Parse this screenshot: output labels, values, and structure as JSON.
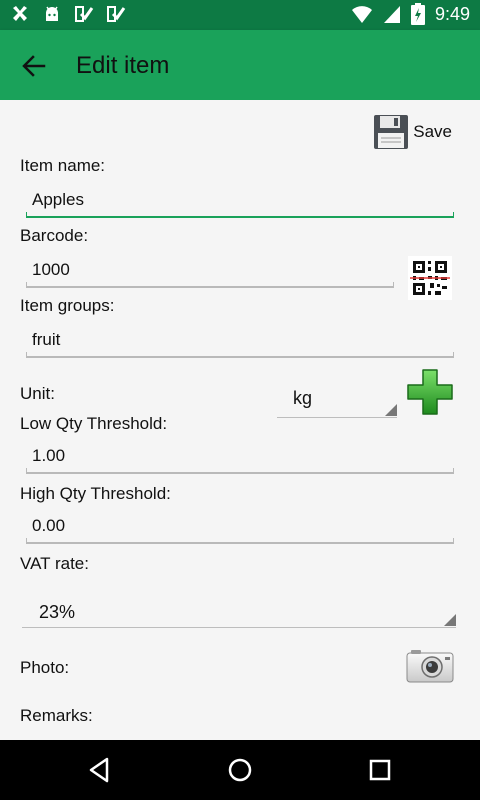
{
  "status_bar": {
    "time": "9:49",
    "left_icons": [
      "notification-icon",
      "android-icon",
      "checklist-icon",
      "checklist-icon"
    ],
    "right_icons": [
      "wifi-icon",
      "signal-icon",
      "battery-icon"
    ]
  },
  "app_bar": {
    "title": "Edit item",
    "background": "#1aa25a"
  },
  "toolbar": {
    "save_label": "Save"
  },
  "form": {
    "item_name_label": "Item name:",
    "item_name_value": "Apples",
    "barcode_label": "Barcode:",
    "barcode_value": "1000",
    "item_groups_label": "Item groups:",
    "item_groups_value": "fruit",
    "unit_label": "Unit:",
    "unit_value": "kg",
    "low_qty_label": "Low Qty Threshold:",
    "low_qty_value": "1.00",
    "high_qty_label": "High Qty Threshold:",
    "high_qty_value": "0.00",
    "vat_label": "VAT rate:",
    "vat_value": "23%",
    "photo_label": "Photo:",
    "remarks_label": "Remarks:"
  }
}
